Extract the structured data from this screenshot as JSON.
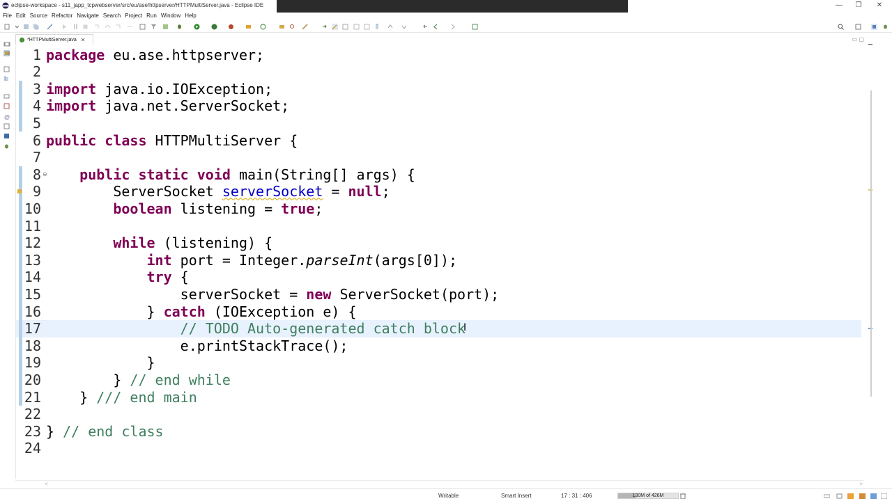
{
  "window": {
    "title": "eclipse-workspace - s11_japp_tcpwebserver/src/eu/ase/httpserver/HTTPMultiServer.java - Eclipse IDE"
  },
  "menu": [
    "File",
    "Edit",
    "Source",
    "Refactor",
    "Navigate",
    "Search",
    "Project",
    "Run",
    "Window",
    "Help"
  ],
  "editor": {
    "tab_label": "*HTTPMultiServer.java",
    "lines": [
      {
        "n": "1",
        "segs": [
          [
            "kw",
            "package"
          ],
          [
            "",
            ""
          ],
          [
            "",
            " eu.ase.httpserver;"
          ]
        ]
      },
      {
        "n": "2",
        "segs": []
      },
      {
        "n": "3",
        "segs": [
          [
            "kw",
            "import"
          ],
          [
            "",
            " java.io.IOException;"
          ]
        ]
      },
      {
        "n": "4",
        "segs": [
          [
            "kw",
            "import"
          ],
          [
            "",
            " java.net.ServerSocket;"
          ]
        ]
      },
      {
        "n": "5",
        "segs": []
      },
      {
        "n": "6",
        "segs": [
          [
            "kw",
            "public"
          ],
          [
            "",
            " "
          ],
          [
            "kw",
            "class"
          ],
          [
            "",
            " HTTPMultiServer {"
          ]
        ]
      },
      {
        "n": "7",
        "segs": []
      },
      {
        "n": "8",
        "segs": [
          [
            "",
            "    "
          ],
          [
            "kw",
            "public"
          ],
          [
            "",
            " "
          ],
          [
            "kw",
            "static"
          ],
          [
            "",
            " "
          ],
          [
            "kw",
            "void"
          ],
          [
            "",
            " main(String[] args) {"
          ]
        ]
      },
      {
        "n": "9",
        "segs": [
          [
            "",
            "        ServerSocket "
          ],
          [
            "warn",
            "serverSocket"
          ],
          [
            "",
            " = "
          ],
          [
            "kw",
            "null"
          ],
          [
            "",
            ";"
          ]
        ]
      },
      {
        "n": "10",
        "segs": [
          [
            "",
            "        "
          ],
          [
            "kw",
            "boolean"
          ],
          [
            "",
            " listening = "
          ],
          [
            "kw",
            "true"
          ],
          [
            "",
            ";"
          ]
        ]
      },
      {
        "n": "11",
        "segs": []
      },
      {
        "n": "12",
        "segs": [
          [
            "",
            "        "
          ],
          [
            "kw",
            "while"
          ],
          [
            "",
            " (listening) {"
          ]
        ]
      },
      {
        "n": "13",
        "segs": [
          [
            "",
            "            "
          ],
          [
            "kw",
            "int"
          ],
          [
            "",
            " port = Integer."
          ],
          [
            "it",
            "parseInt"
          ],
          [
            "",
            "(args[0]);"
          ]
        ]
      },
      {
        "n": "14",
        "segs": [
          [
            "",
            "            "
          ],
          [
            "kw",
            "try"
          ],
          [
            "",
            " {"
          ]
        ]
      },
      {
        "n": "15",
        "segs": [
          [
            "",
            "                serverSocket = "
          ],
          [
            "kw",
            "new"
          ],
          [
            "",
            " ServerSocket(port);"
          ]
        ]
      },
      {
        "n": "16",
        "segs": [
          [
            "",
            "            } "
          ],
          [
            "kw",
            "catch"
          ],
          [
            "",
            " (IOException e) {"
          ]
        ]
      },
      {
        "n": "17",
        "segs": [
          [
            "",
            "                "
          ],
          [
            "cmt",
            "// TODO Auto-generated catch block"
          ]
        ]
      },
      {
        "n": "18",
        "segs": [
          [
            "",
            "                e.printStackTrace();"
          ]
        ]
      },
      {
        "n": "19",
        "segs": [
          [
            "",
            "            }"
          ]
        ]
      },
      {
        "n": "20",
        "segs": [
          [
            "",
            "        } "
          ],
          [
            "cmt",
            "// end while"
          ]
        ]
      },
      {
        "n": "21",
        "segs": [
          [
            "",
            "    } "
          ],
          [
            "cmt",
            "/// end main"
          ]
        ]
      },
      {
        "n": "22",
        "segs": []
      },
      {
        "n": "23",
        "segs": [
          [
            "",
            "} "
          ],
          [
            "cmt",
            "// end class"
          ]
        ]
      },
      {
        "n": "24",
        "segs": []
      }
    ]
  },
  "status": {
    "mode": "Writable",
    "insert": "Smart Insert",
    "position": "17 : 31 : 406",
    "heap": "130M of 426M",
    "heap_fraction": 0.305
  },
  "colors": {
    "keyword": "#7f0055",
    "comment": "#3f7f5f",
    "field": "#0000c0",
    "current_line": "#e8f2fe"
  }
}
